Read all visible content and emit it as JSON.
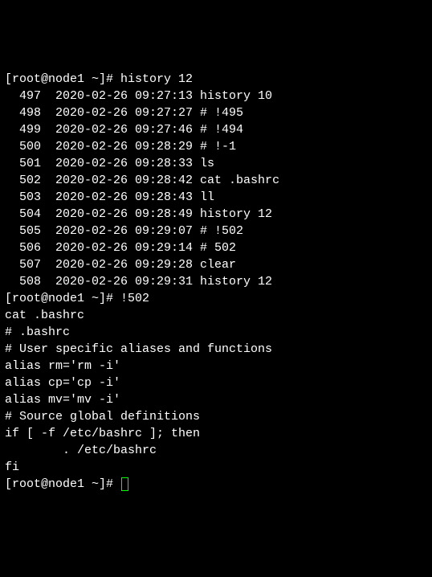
{
  "prompt1": "[root@node1 ~]# ",
  "cmd1": "history 12",
  "history_entries": [
    {
      "num": "  497",
      "date": "  2020-02-26 09:27:13",
      "cmd": " history 10"
    },
    {
      "num": "  498",
      "date": "  2020-02-26 09:27:27",
      "cmd": " # !495"
    },
    {
      "num": "  499",
      "date": "  2020-02-26 09:27:46",
      "cmd": " # !494"
    },
    {
      "num": "  500",
      "date": "  2020-02-26 09:28:29",
      "cmd": " # !-1"
    },
    {
      "num": "  501",
      "date": "  2020-02-26 09:28:33",
      "cmd": " ls"
    },
    {
      "num": "  502",
      "date": "  2020-02-26 09:28:42",
      "cmd": " cat .bashrc"
    },
    {
      "num": "  503",
      "date": "  2020-02-26 09:28:43",
      "cmd": " ll"
    },
    {
      "num": "  504",
      "date": "  2020-02-26 09:28:49",
      "cmd": " history 12"
    },
    {
      "num": "  505",
      "date": "  2020-02-26 09:29:07",
      "cmd": " # !502"
    },
    {
      "num": "  506",
      "date": "  2020-02-26 09:29:14",
      "cmd": " # 502"
    },
    {
      "num": "  507",
      "date": "  2020-02-26 09:29:28",
      "cmd": " clear"
    },
    {
      "num": "  508",
      "date": "  2020-02-26 09:29:31",
      "cmd": " history 12"
    }
  ],
  "prompt2": "[root@node1 ~]# ",
  "cmd2": "!502",
  "expanded_cmd": "cat .bashrc",
  "bashrc_lines": [
    "# .bashrc",
    "",
    "# User specific aliases and functions",
    "",
    "alias rm='rm -i'",
    "alias cp='cp -i'",
    "alias mv='mv -i'",
    "",
    "# Source global definitions",
    "if [ -f /etc/bashrc ]; then",
    "        . /etc/bashrc",
    "fi"
  ],
  "prompt3": "[root@node1 ~]# "
}
